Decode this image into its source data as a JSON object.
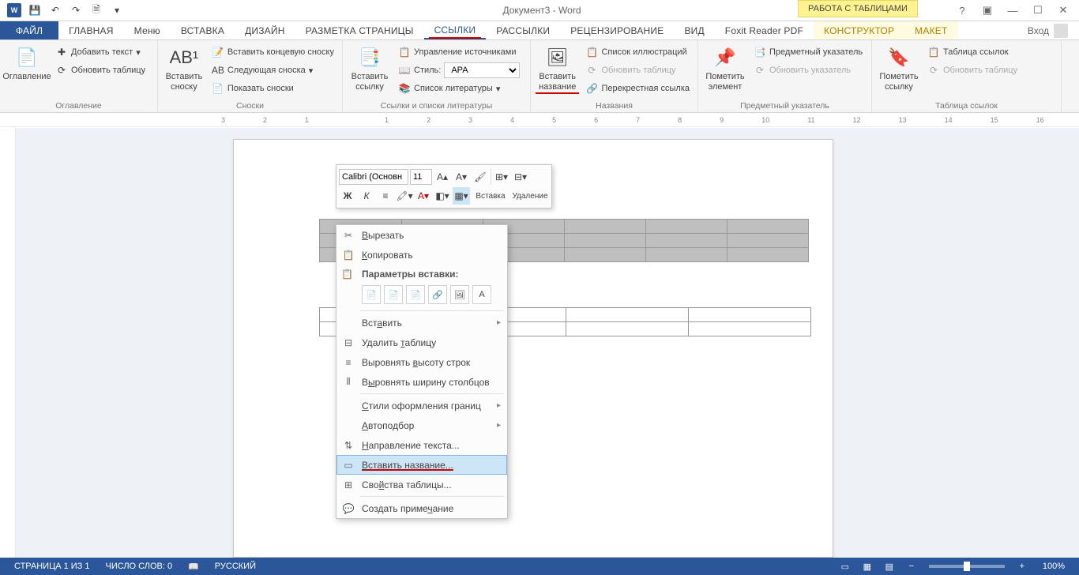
{
  "title": "Документ3 - Word",
  "table_tools": "РАБОТА С ТАБЛИЦАМИ",
  "tabs": {
    "file": "ФАЙЛ",
    "home": "ГЛАВНАЯ",
    "menu": "Меню",
    "insert": "ВСТАВКА",
    "design": "ДИЗАЙН",
    "layout": "РАЗМЕТКА СТРАНИЦЫ",
    "references": "ССЫЛКИ",
    "mailings": "РАССЫЛКИ",
    "review": "РЕЦЕНЗИРОВАНИЕ",
    "view": "ВИД",
    "foxit": "Foxit Reader PDF",
    "constructor": "КОНСТРУКТОР",
    "tbl_layout": "МАКЕТ",
    "login": "Вход"
  },
  "ribbon": {
    "toc": {
      "btn": "Оглавление",
      "add_text": "Добавить текст",
      "update": "Обновить таблицу",
      "group": "Оглавление"
    },
    "footnotes": {
      "btn": "Вставить сноску",
      "end": "Вставить концевую сноску",
      "next": "Следующая сноска",
      "show": "Показать сноски",
      "group": "Сноски"
    },
    "citations": {
      "btn": "Вставить ссылку",
      "manage": "Управление источниками",
      "style": "Стиль:",
      "style_val": "APA",
      "bib": "Список литературы",
      "group": "Ссылки и списки литературы"
    },
    "captions": {
      "btn": "Вставить название",
      "list": "Список иллюстраций",
      "update": "Обновить таблицу",
      "cross": "Перекрестная ссылка",
      "group": "Названия"
    },
    "index": {
      "btn": "Пометить элемент",
      "idx": "Предметный указатель",
      "update": "Обновить указатель",
      "group": "Предметный указатель"
    },
    "toa": {
      "btn": "Пометить ссылку",
      "tbl": "Таблица ссылок",
      "update": "Обновить таблицу",
      "group": "Таблица ссылок"
    }
  },
  "mini": {
    "font": "Calibri (Основн",
    "size": "11",
    "insert": "Вставка",
    "delete": "Удаление"
  },
  "context": {
    "cut": "Вырезать",
    "copy": "Копировать",
    "paste_header": "Параметры вставки:",
    "insert": "Вставить",
    "delete_tbl": "Удалить таблицу",
    "dist_rows": "Выровнять высоту строк",
    "dist_cols": "Выровнять ширину столбцов",
    "border_styles": "Стили оформления границ",
    "autofit": "Автоподбор",
    "text_dir": "Направление текста...",
    "insert_caption": "Вставить название...",
    "tbl_props": "Свойства таблицы...",
    "new_comment": "Создать примечание"
  },
  "status": {
    "page": "СТРАНИЦА 1 ИЗ 1",
    "words": "ЧИСЛО СЛОВ: 0",
    "lang": "РУССКИЙ",
    "zoom": "100%"
  }
}
